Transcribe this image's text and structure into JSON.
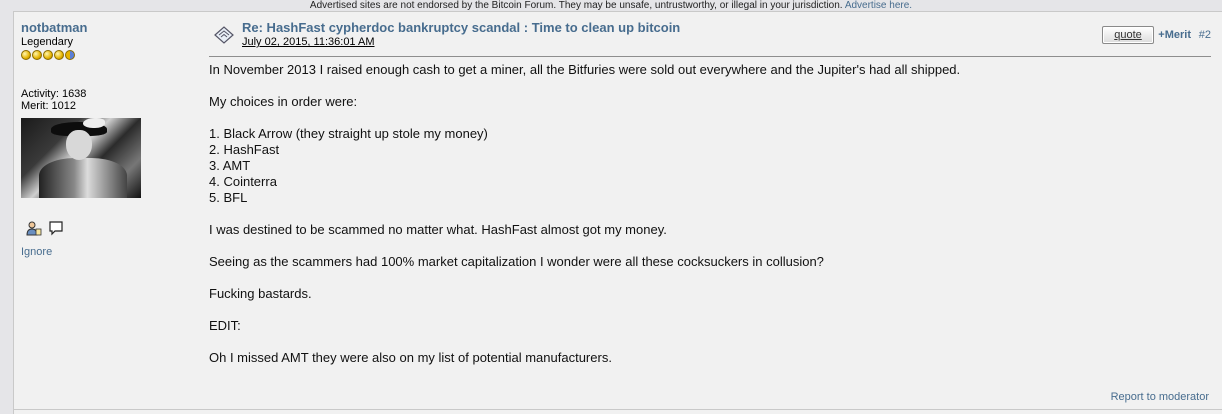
{
  "banner": {
    "text": "Advertised sites are not endorsed by the Bitcoin Forum. They may be unsafe, untrustworthy, or illegal in your jurisdiction.",
    "link": "Advertise here."
  },
  "poster": {
    "name": "notbatman",
    "rank": "Legendary",
    "activity": "Activity: 1638",
    "merit": "Merit: 1012",
    "ignore": "Ignore",
    "stars_full": 4,
    "stars_half": 1
  },
  "post": {
    "title": "Re: HashFast cypherdoc bankruptcy scandal : Time to clean up bitcoin",
    "date": "July 02, 2015, 11:36:01 AM",
    "quote_label": "quote",
    "merit_label": "+Merit",
    "number": "#2",
    "body": {
      "p1": "In November 2013 I raised enough cash to get a miner, all the Bitfuries were sold out everywhere and the Jupiter's had all shipped.",
      "p2": "My choices in order were:",
      "list": [
        "1. Black Arrow (they straight up stole my money)",
        "2. HashFast",
        "3. AMT",
        "4. Cointerra",
        "5. BFL"
      ],
      "p3": "I was destined to be scammed no matter what. HashFast almost got my money.",
      "p4": "Seeing as the scammers had 100% market capitalization I wonder were all these cocksuckers in collusion?",
      "p5": "Fucking bastards.",
      "p6": "EDIT:",
      "p7": "Oh I missed AMT they were also on my list of potential manufacturers."
    },
    "report_label": "Report to moderator"
  }
}
